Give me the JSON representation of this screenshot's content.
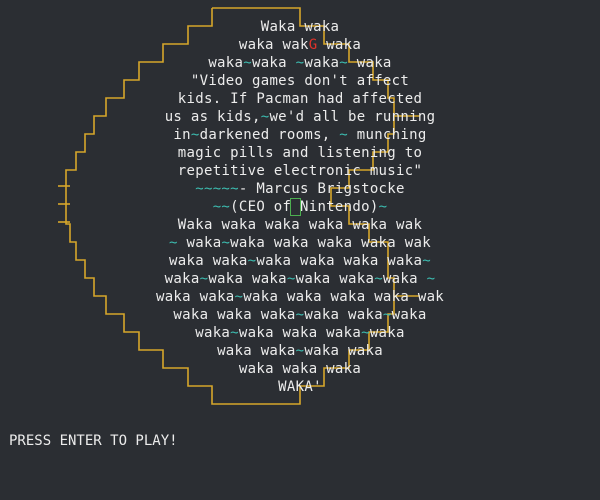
{
  "colors": {
    "background": "#2b2e33",
    "text": "#ececec",
    "tilde": "#3cbcb0",
    "highlight": "#e0332a",
    "border": "#d6a62b",
    "cursor": "#4caf50"
  },
  "art_lines": [
    [
      {
        "t": "Waka waka"
      }
    ],
    [
      {
        "t": "waka wak"
      },
      {
        "t": "G",
        "c": "r"
      },
      {
        "t": " waka"
      }
    ],
    [
      {
        "t": "waka"
      },
      {
        "t": "~",
        "c": "g"
      },
      {
        "t": "waka "
      },
      {
        "t": "~",
        "c": "g"
      },
      {
        "t": "waka"
      },
      {
        "t": "~",
        "c": "g"
      },
      {
        "t": " waka"
      }
    ],
    [
      {
        "t": "\"Video games don't affect"
      }
    ],
    [
      {
        "t": "kids. If Pacman had affected"
      }
    ],
    [
      {
        "t": "us as kids,"
      },
      {
        "t": "~",
        "c": "g"
      },
      {
        "t": "we'd all be running"
      }
    ],
    [
      {
        "t": "in"
      },
      {
        "t": "~",
        "c": "g"
      },
      {
        "t": "darkened rooms, "
      },
      {
        "t": "~",
        "c": "g"
      },
      {
        "t": " munching"
      }
    ],
    [
      {
        "t": "magic pills and listening to"
      }
    ],
    [
      {
        "t": "repetitive electronic music\""
      }
    ],
    [
      {
        "t": "~~~~~",
        "c": "g"
      },
      {
        "t": "- Marcus Brigstocke"
      }
    ],
    [
      {
        "t": "~~",
        "c": "g"
      },
      {
        "t": "(CEO of"
      },
      {
        "t": " ",
        "k": "cursor"
      },
      {
        "t": "Nintendo)"
      },
      {
        "t": "~",
        "c": "g"
      }
    ],
    [
      {
        "t": "Waka waka waka waka waka wak"
      }
    ],
    [
      {
        "t": "~",
        "c": "g"
      },
      {
        "t": " waka"
      },
      {
        "t": "~",
        "c": "g"
      },
      {
        "t": "waka waka waka waka wak"
      }
    ],
    [
      {
        "t": "waka waka"
      },
      {
        "t": "~",
        "c": "g"
      },
      {
        "t": "waka waka waka waka"
      },
      {
        "t": "~",
        "c": "g"
      }
    ],
    [
      {
        "t": "waka"
      },
      {
        "t": "~",
        "c": "g"
      },
      {
        "t": "waka waka"
      },
      {
        "t": "~",
        "c": "g"
      },
      {
        "t": "waka waka"
      },
      {
        "t": "~",
        "c": "g"
      },
      {
        "t": "waka "
      },
      {
        "t": "~",
        "c": "g"
      }
    ],
    [
      {
        "t": "waka waka"
      },
      {
        "t": "~",
        "c": "g"
      },
      {
        "t": "waka waka waka waka wak"
      }
    ],
    [
      {
        "t": "waka waka waka"
      },
      {
        "t": "~",
        "c": "g"
      },
      {
        "t": "waka waka"
      },
      {
        "t": "~",
        "c": "g"
      },
      {
        "t": "waka"
      }
    ],
    [
      {
        "t": "waka"
      },
      {
        "t": "~",
        "c": "g"
      },
      {
        "t": "waka waka waka"
      },
      {
        "t": "~",
        "c": "g"
      },
      {
        "t": "waka"
      }
    ],
    [
      {
        "t": "waka waka"
      },
      {
        "t": "~",
        "c": "g"
      },
      {
        "t": "waka waka"
      }
    ],
    [
      {
        "t": "waka waka waka"
      }
    ],
    [
      {
        "t": "WAKA'"
      }
    ]
  ],
  "prompt": "PRESS ENTER TO PLAY!"
}
